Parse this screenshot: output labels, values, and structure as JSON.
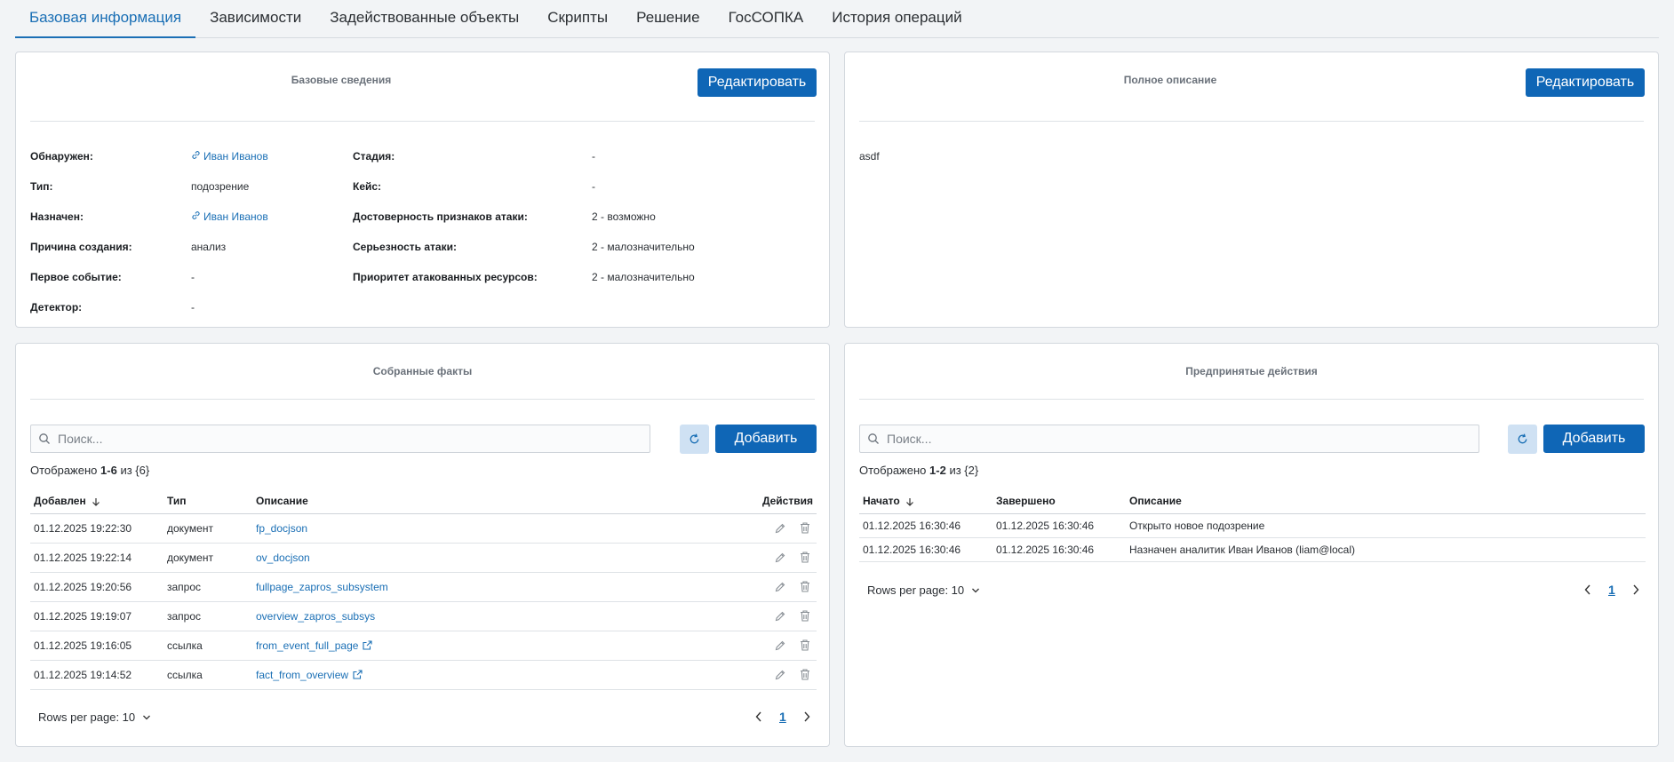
{
  "tabs": [
    "Базовая информация",
    "Зависимости",
    "Задействованные объекты",
    "Скрипты",
    "Решение",
    "ГосСОПКА",
    "История операций"
  ],
  "base_info": {
    "title": "Базовые сведения",
    "edit_label": "Редактировать",
    "left": [
      {
        "label": "Обнаружен:",
        "value": "Иван Иванов",
        "link": true
      },
      {
        "label": "Тип:",
        "value": "подозрение",
        "link": false
      },
      {
        "label": "Назначен:",
        "value": "Иван Иванов",
        "link": true
      },
      {
        "label": "Причина создания:",
        "value": "анализ",
        "link": false
      },
      {
        "label": "Первое событие:",
        "value": "-",
        "link": false
      },
      {
        "label": "Детектор:",
        "value": "-",
        "link": false
      }
    ],
    "right": [
      {
        "label": "Стадия:",
        "value": "-"
      },
      {
        "label": "Кейс:",
        "value": "-"
      },
      {
        "label": "Достоверность признаков атаки:",
        "value": "2 - возможно"
      },
      {
        "label": "Серьезность атаки:",
        "value": "2 - малозначительно"
      },
      {
        "label": "Приоритет атакованных ресурсов:",
        "value": "2 - малозначительно"
      }
    ]
  },
  "description": {
    "title": "Полное описание",
    "edit_label": "Редактировать",
    "text": "asdf"
  },
  "facts": {
    "title": "Собранные факты",
    "search_placeholder": "Поиск...",
    "add_label": "Добавить",
    "count_prefix": "Отображено",
    "count_range": "1-6",
    "count_suffix": "из {6}",
    "columns": [
      "Добавлен",
      "Тип",
      "Описание",
      "Действия"
    ],
    "rows": [
      {
        "added": "01.12.2025 19:22:30",
        "type": "документ",
        "desc": "fp_docjson",
        "ext": false
      },
      {
        "added": "01.12.2025 19:22:14",
        "type": "документ",
        "desc": "ov_docjson",
        "ext": false
      },
      {
        "added": "01.12.2025 19:20:56",
        "type": "запрос",
        "desc": "fullpage_zapros_subsystem",
        "ext": false
      },
      {
        "added": "01.12.2025 19:19:07",
        "type": "запрос",
        "desc": "overview_zapros_subsys",
        "ext": false
      },
      {
        "added": "01.12.2025 19:16:05",
        "type": "ссылка",
        "desc": "from_event_full_page",
        "ext": true
      },
      {
        "added": "01.12.2025 19:14:52",
        "type": "ссылка",
        "desc": "fact_from_overview",
        "ext": true
      }
    ],
    "rows_per_page": "Rows per page: 10",
    "page": "1"
  },
  "actions": {
    "title": "Предпринятые действия",
    "search_placeholder": "Поиск...",
    "add_label": "Добавить",
    "count_prefix": "Отображено",
    "count_range": "1-2",
    "count_suffix": "из {2}",
    "columns": [
      "Начато",
      "Завершено",
      "Описание"
    ],
    "rows": [
      {
        "start": "01.12.2025 16:30:46",
        "end": "01.12.2025 16:30:46",
        "desc": "Открыто новое подозрение"
      },
      {
        "start": "01.12.2025 16:30:46",
        "end": "01.12.2025 16:30:46",
        "desc": "Назначен аналитик Иван Иванов (liam@local)"
      }
    ],
    "rows_per_page": "Rows per page: 10",
    "page": "1"
  },
  "colors": {
    "accent": "#0f66b6",
    "link": "#1a6fb5",
    "refresh_bg": "#cfe1f3"
  },
  "icons": [
    "link-icon",
    "search-icon",
    "refresh-icon",
    "sort-arrow-down-icon",
    "pencil-icon",
    "trash-icon",
    "external-link-icon",
    "chevron-down-icon",
    "chevron-left-icon",
    "chevron-right-icon"
  ]
}
